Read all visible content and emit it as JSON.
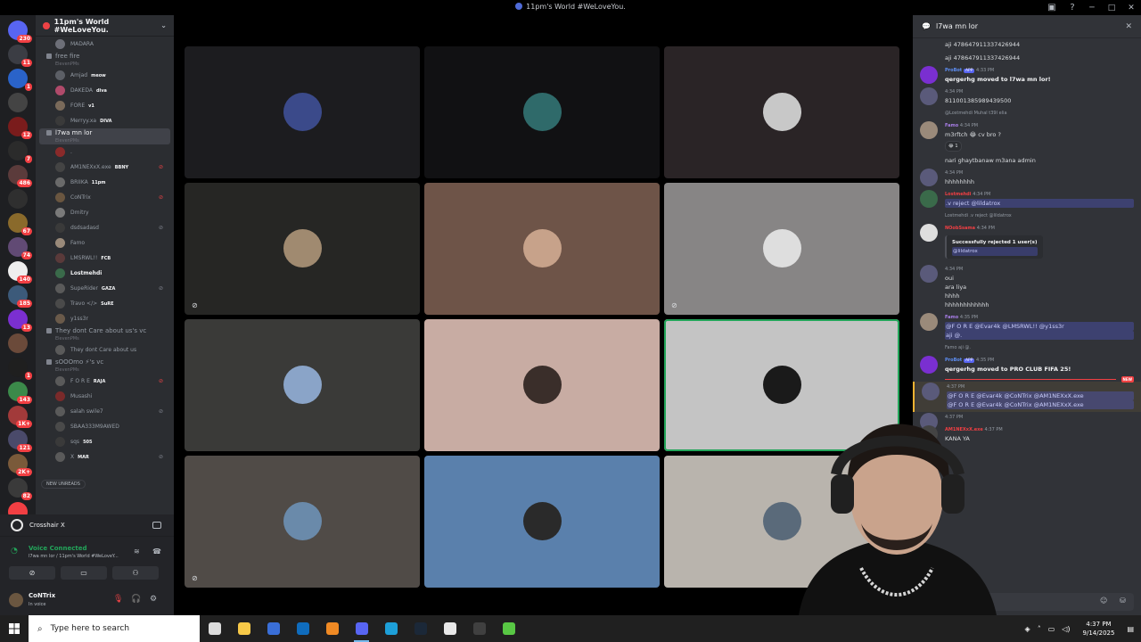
{
  "window": {
    "title": "11pm's World #WeLoveYou."
  },
  "server": {
    "name": "11pm's World #WeLoveYou."
  },
  "rail": {
    "servers": [
      {
        "color": "#5865f2",
        "badge": "230"
      },
      {
        "color": "#3b3d44",
        "badge": "11"
      },
      {
        "color": "#2a63c9",
        "badge": "1"
      },
      {
        "color": "#444",
        "badge": ""
      },
      {
        "color": "#7a1c1c",
        "badge": "12"
      },
      {
        "color": "#2b2b2b",
        "badge": "7"
      },
      {
        "color": "#5b3b3b",
        "badge": "486"
      },
      {
        "color": "#2f2f2f",
        "badge": ""
      },
      {
        "color": "#8a6a2b",
        "badge": "67"
      },
      {
        "color": "#614a74",
        "badge": "74"
      },
      {
        "color": "#eeeeee",
        "badge": "140"
      },
      {
        "color": "#3c5a7a",
        "badge": "185"
      },
      {
        "color": "#7b2fd1",
        "badge": "13"
      },
      {
        "color": "#6b4a3a",
        "badge": ""
      },
      {
        "color": "#1f1f1f",
        "badge": "1"
      },
      {
        "color": "#3b8a4a",
        "badge": "143"
      },
      {
        "color": "#a23a3a",
        "badge": "1K+"
      },
      {
        "color": "#4a4a6a",
        "badge": "121"
      },
      {
        "color": "#7a5a3a",
        "badge": "2K+"
      },
      {
        "color": "#3a3a3a",
        "badge": "82"
      },
      {
        "color": "#f23f43",
        "badge": "NEW"
      }
    ]
  },
  "channels": [
    {
      "name": "",
      "sub": "",
      "active": false,
      "members": [
        {
          "name": "MADARA",
          "tag": "",
          "mic": "",
          "color": "#6d6f78"
        }
      ]
    },
    {
      "name": "free fire",
      "sub": "ElevenPMs",
      "active": false,
      "members": [
        {
          "name": "Amjad",
          "tag": "meow",
          "mic": "",
          "color": "#5c5f66"
        },
        {
          "name": "DAKEDA",
          "tag": "diva",
          "mic": "",
          "color": "#b04a6a"
        },
        {
          "name": "FORE",
          "tag": "v1",
          "mic": "",
          "color": "#7a6a5a"
        },
        {
          "name": "Merryy.xa",
          "tag": "DIVA",
          "mic": "",
          "color": "#3a3a3a"
        }
      ]
    },
    {
      "name": "l7wa mn lor",
      "sub": "ElevenPMs",
      "active": true,
      "members": [
        {
          "name": ".",
          "tag": "",
          "mic": "",
          "color": "#8a2a2a"
        },
        {
          "name": "AM1NEXxX.exe",
          "tag": "BBNY",
          "mic": "red",
          "color": "#444"
        },
        {
          "name": "BRIIKA",
          "tag": "11pm",
          "mic": "",
          "color": "#6a6a6a"
        },
        {
          "name": "CoNTrix",
          "tag": "",
          "mic": "red",
          "color": "#6a5640"
        },
        {
          "name": "Dmitry",
          "tag": "",
          "mic": "",
          "color": "#7a7a7a"
        },
        {
          "name": "dsdsadasd",
          "tag": "",
          "mic": "gray",
          "color": "#3a3a3a"
        },
        {
          "name": "Famo",
          "tag": "",
          "mic": "",
          "color": "#9a8a7a"
        },
        {
          "name": "LMSRWL!!",
          "tag": "FCB",
          "mic": "",
          "color": "#5a3a3a"
        },
        {
          "name": "Lostmehdi",
          "tag": "",
          "mic": "",
          "color": "#3a6a4a"
        },
        {
          "name": "SupeRider",
          "tag": "GAZA",
          "mic": "gray",
          "color": "#5a5a5a"
        },
        {
          "name": "Travo </>",
          "tag": "SuRE",
          "mic": "",
          "color": "#4a4a4a"
        },
        {
          "name": "y1ss3r",
          "tag": "",
          "mic": "",
          "color": "#6a5a4a"
        }
      ]
    },
    {
      "name": "They dont Care about us's vc",
      "sub": "ElevenPMs",
      "active": false,
      "members": [
        {
          "name": "They dont Care about us",
          "tag": "",
          "mic": "",
          "color": "#5a5a5a"
        }
      ]
    },
    {
      "name": "sOOOmo ⚡'s vc",
      "sub": "ElevenPMs",
      "active": false,
      "members": [
        {
          "name": "F O R E",
          "tag": "RAJA",
          "mic": "red",
          "color": "#5a5a5a"
        },
        {
          "name": "Musashi",
          "tag": "",
          "mic": "",
          "color": "#7a2a2a"
        },
        {
          "name": "salah swile7",
          "tag": "",
          "mic": "gray",
          "color": "#5a5a5a"
        },
        {
          "name": "SBAA333M9AWED",
          "tag": "",
          "mic": "",
          "color": "#4a4a4a"
        },
        {
          "name": "sqs",
          "tag": "505",
          "mic": "",
          "color": "#3a3a3a"
        },
        {
          "name": "X",
          "tag": "MAR",
          "mic": "gray",
          "color": "#5a5a5a"
        }
      ]
    }
  ],
  "new_unreads": "NEW UNREADS",
  "crosshair": {
    "label": "Crosshair X"
  },
  "voice": {
    "status": "Voice Connected",
    "location": "l7wa mn lor / 11pm's World #WeLoveY..."
  },
  "user": {
    "name": "CoNTrix",
    "status": "In voice"
  },
  "tiles": [
    {
      "bg": "#1c1c1f",
      "av": "#3b4a8a",
      "muted": false,
      "speaking": false
    },
    {
      "bg": "#111113",
      "av": "#2f6a6a",
      "muted": false,
      "speaking": false
    },
    {
      "bg": "#2a2426",
      "av": "#c8c8c8",
      "muted": false,
      "speaking": false
    },
    {
      "bg": "#262624",
      "av": "#a08a70",
      "muted": true,
      "speaking": false
    },
    {
      "bg": "#6e5448",
      "av": "#c7a28a",
      "muted": false,
      "speaking": false
    },
    {
      "bg": "#878585",
      "av": "#dedede",
      "muted": true,
      "speaking": false
    },
    {
      "bg": "#3a3a38",
      "av": "#8aa4c8",
      "muted": false,
      "speaking": false
    },
    {
      "bg": "#c8aca3",
      "av": "#3a2e2a",
      "muted": false,
      "speaking": false
    },
    {
      "bg": "#c4c4c4",
      "av": "#1a1a1a",
      "muted": false,
      "speaking": true
    },
    {
      "bg": "#504b47",
      "av": "#6a8aaa",
      "muted": true,
      "speaking": false
    },
    {
      "bg": "#5a80ac",
      "av": "#2a2a2a",
      "muted": false,
      "speaking": false
    },
    {
      "bg": "#b9b4ad",
      "av": "#5a6a7a",
      "muted": false,
      "speaking": false
    }
  ],
  "chat": {
    "title": "l7wa mn lor",
    "messages": [
      {
        "kind": "cont",
        "text": "aji 478647911337426944",
        "meta": ""
      },
      {
        "kind": "cont",
        "text": "aji 478647911337426944",
        "meta": "Famo"
      },
      {
        "kind": "bot",
        "author": "ProBot",
        "time": "4:33 PM",
        "text": "qergerhg moved to l7wa mn lor!",
        "av": "#7a2fd1"
      },
      {
        "kind": "msg",
        "author": "",
        "time": "4:34 PM",
        "text": "811001385989439500",
        "av": "#5a5a7a"
      },
      {
        "kind": "reply",
        "text": "@Lostmehdi Muhal t39l elia"
      },
      {
        "kind": "msg",
        "author": "Famo",
        "time": "4:34 PM",
        "text": "m3rftch 😂 cv bro ?",
        "av": "#9a8a7a",
        "react": "😂 1"
      },
      {
        "kind": "cont",
        "text": "nari ghaytbanaw m3ana admin",
        "meta": ""
      },
      {
        "kind": "msg",
        "author": "",
        "time": "4:34 PM",
        "text": "hhhhhhhh",
        "av": "#5a5a7a"
      },
      {
        "kind": "msg",
        "author": "Lostmehdi",
        "time": "4:34 PM",
        "text": ".v reject @lildatrox",
        "av": "#3a6a4a",
        "mention": true
      },
      {
        "kind": "reply",
        "text": "Lostmehdi .v reject @lildatrox"
      },
      {
        "kind": "msg",
        "author": "NOobSsama",
        "time": "4:34 PM",
        "text": "",
        "av": "#dedede",
        "embed": "Successfully rejected 1 user(s)",
        "embedsub": "@lildatrox"
      },
      {
        "kind": "msg",
        "author": "",
        "time": "4:34 PM",
        "text": "oui",
        "av": "#5a5a7a",
        "extra": [
          "ara liya",
          "hhhh",
          "hhhhhhhhhhhh"
        ]
      },
      {
        "kind": "msg",
        "author": "Famo",
        "time": "4:35 PM",
        "text": "@F O R E @Evar4k @LMSRWL!! @y1ss3r",
        "av": "#9a8a7a",
        "mention": true,
        "extra": [
          "aji @."
        ]
      },
      {
        "kind": "reply",
        "text": "Famo aji @."
      },
      {
        "kind": "bot",
        "author": "ProBot",
        "time": "4:35 PM",
        "text": "qergerhg moved to PRO CLUB FIFA 25!",
        "av": "#7a2fd1"
      },
      {
        "kind": "newbar",
        "text": "NEW"
      },
      {
        "kind": "msg",
        "author": "",
        "time": "4:37 PM",
        "text": "@F O R E @Evar4k @CoNTrix @AM1NEXxX.exe",
        "av": "#5a5a7a",
        "mention": true,
        "hl": true,
        "extra": [
          "@F O R E @Evar4k @CoNTrix @AM1NEXxX.exe"
        ]
      },
      {
        "kind": "msg",
        "author": "",
        "time": "4:37 PM",
        "text": "",
        "av": "#5a5a7a"
      },
      {
        "kind": "msg",
        "author": "AM1NEXxX.exe",
        "time": "4:37 PM",
        "text": "KANA YA",
        "av": "#444"
      }
    ]
  },
  "taskbar": {
    "search_placeholder": "Type here to search",
    "time": "4:37 PM",
    "date": "9/14/2025",
    "apps": [
      {
        "name": "task-view",
        "color": "#dcdcdc",
        "active": false
      },
      {
        "name": "file-explorer",
        "color": "#f7c948",
        "active": false
      },
      {
        "name": "store",
        "color": "#3a6fd8",
        "active": false
      },
      {
        "name": "outlook",
        "color": "#0f6cbd",
        "active": false
      },
      {
        "name": "app-a",
        "color": "#f08a24",
        "active": false
      },
      {
        "name": "discord",
        "color": "#5865f2",
        "active": true
      },
      {
        "name": "edge",
        "color": "#1d9fd8",
        "active": false
      },
      {
        "name": "steam",
        "color": "#1b2838",
        "active": false
      },
      {
        "name": "crosshair",
        "color": "#e8e8e8",
        "active": false
      },
      {
        "name": "obs",
        "color": "#404040",
        "active": false
      },
      {
        "name": "app-b",
        "color": "#58c744",
        "active": false
      }
    ]
  }
}
